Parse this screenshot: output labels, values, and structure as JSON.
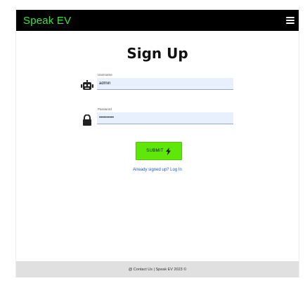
{
  "navbar": {
    "brand": "Speak EV",
    "menu_icon": "hamburger-menu-icon"
  },
  "form": {
    "title": "Sign Up",
    "username": {
      "label": "Username",
      "value": "admin",
      "icon": "robot-icon"
    },
    "password": {
      "label": "Password",
      "value": "••••••••••",
      "icon": "lock-icon"
    },
    "submit_label": "SUBMIT",
    "submit_icon": "lightning-bolt-icon",
    "login_link": "Already signed up? Log In"
  },
  "footer": {
    "text": "@ Contact Us | Speak EV 2023 ©"
  },
  "colors": {
    "navbar_bg": "#000000",
    "brand": "#39e639",
    "submit_bg": "#5fe60a",
    "input_bg": "#e8f0fe",
    "link": "#1a56c8",
    "footer_bg": "#e0e0e0"
  }
}
